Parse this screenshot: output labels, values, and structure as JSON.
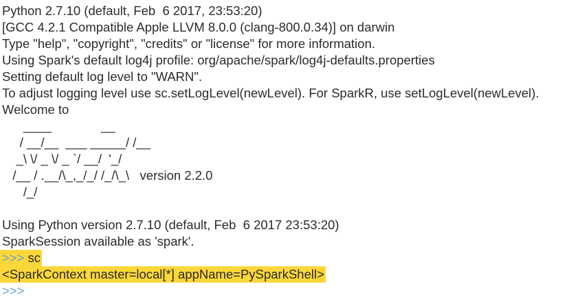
{
  "terminal": {
    "lines": [
      "Python 2.7.10 (default, Feb  6 2017, 23:53:20)",
      "[GCC 4.2.1 Compatible Apple LLVM 8.0.0 (clang-800.0.34)] on darwin",
      "Type \"help\", \"copyright\", \"credits\" or \"license\" for more information.",
      "Using Spark's default log4j profile: org/apache/spark/log4j-defaults.properties",
      "Setting default log level to \"WARN\".",
      "To adjust logging level use sc.setLogLevel(newLevel). For SparkR, use setLogLevel(newLevel).",
      "Welcome to"
    ],
    "banner": [
      "      ____              __",
      "     / __/__  ___ _____/ /__",
      "    _\\ \\/ _ \\/ _ `/ __/  '_/",
      "   /__ / .__/\\_,_/_/ /_/\\_\\   version 2.2.0",
      "      /_/"
    ],
    "after_banner": [
      "Using Python version 2.7.10 (default, Feb  6 2017 23:53:20)",
      "SparkSession available as 'spark'."
    ],
    "prompt_symbol": ">>>",
    "command": " sc",
    "output": "<SparkContext master=local[*] appName=PySparkShell>",
    "empty_prompt": ">>>"
  },
  "colors": {
    "highlight": "#fcd73a",
    "prompt": "#6aa3d6",
    "text": "#2b2b2b"
  }
}
